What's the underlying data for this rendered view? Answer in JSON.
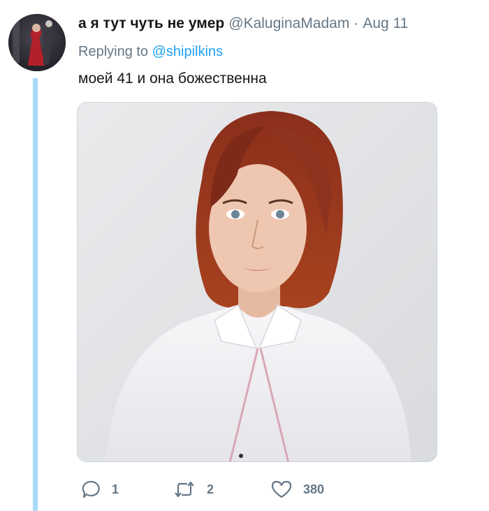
{
  "tweet": {
    "display_name": "а я тут чуть не умер",
    "handle": "@KaluginaMadam",
    "separator": "·",
    "date": "Aug 11",
    "replying_prefix": "Replying to ",
    "replying_to": "@shipilkins",
    "text": "моей 41 и она божественна"
  },
  "actions": {
    "replies": "1",
    "retweets": "2",
    "likes": "380"
  },
  "icons": {
    "reply": "reply-icon",
    "retweet": "retweet-icon",
    "like": "heart-icon"
  },
  "colors": {
    "link": "#1da1f2",
    "secondary_text": "#657786",
    "thread_line": "#a7daf9"
  }
}
